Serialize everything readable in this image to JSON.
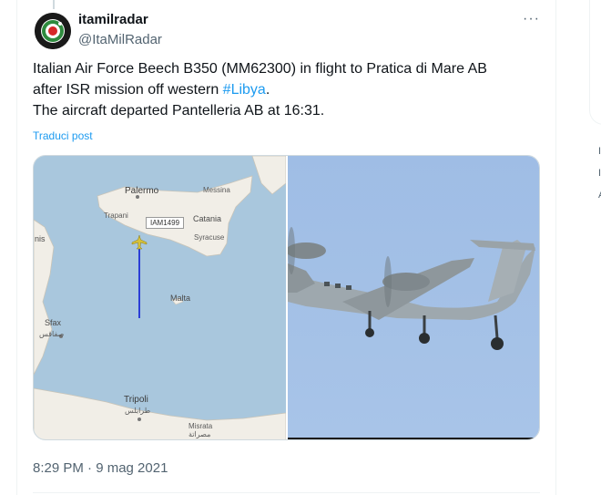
{
  "tweet": {
    "display_name": "itamilradar",
    "handle": "@ItaMilRadar",
    "more_label": "···",
    "text_line1": "Italian Air Force Beech B350 (MM62300) in flight to Pratica di Mare AB",
    "text_line2_prefix": "after ISR mission off western ",
    "hashtag": "#Libya",
    "text_line2_suffix": ".",
    "text_line3": "The aircraft departed Pantelleria AB at 16:31.",
    "translate_label": "Traduci post",
    "timestamp": "8:29 PM · 9 mag 2021"
  },
  "map": {
    "labels": {
      "palermo": "Palermo",
      "messina": "Messina",
      "trapani": "Trapani",
      "catania": "Catania",
      "syracuse": "Syracuse",
      "tunis": "nis",
      "malta": "Malta",
      "sfax": "Sfax",
      "sfax_ar": "صفاقس",
      "tripoli": "Tripoli",
      "tripoli_ar": "طرابلس",
      "misrata": "Misrata",
      "misrata_ar": "مصراتة"
    },
    "callsign": "IAM1499",
    "colors": {
      "sea": "#a9c7dd",
      "land": "#f1eee7",
      "track": "#2b3ed6",
      "aircraft": "#d8c23a"
    }
  },
  "photo": {
    "sky_color": "#a3c0e6",
    "aircraft_color": "#9ea8ae"
  },
  "sidebar_fragments": [
    "I",
    "I",
    "A"
  ],
  "icons": {
    "avatar": "roundel-logo-icon",
    "aircraft": "aircraft-marker-icon",
    "more": "more-dots-icon"
  }
}
